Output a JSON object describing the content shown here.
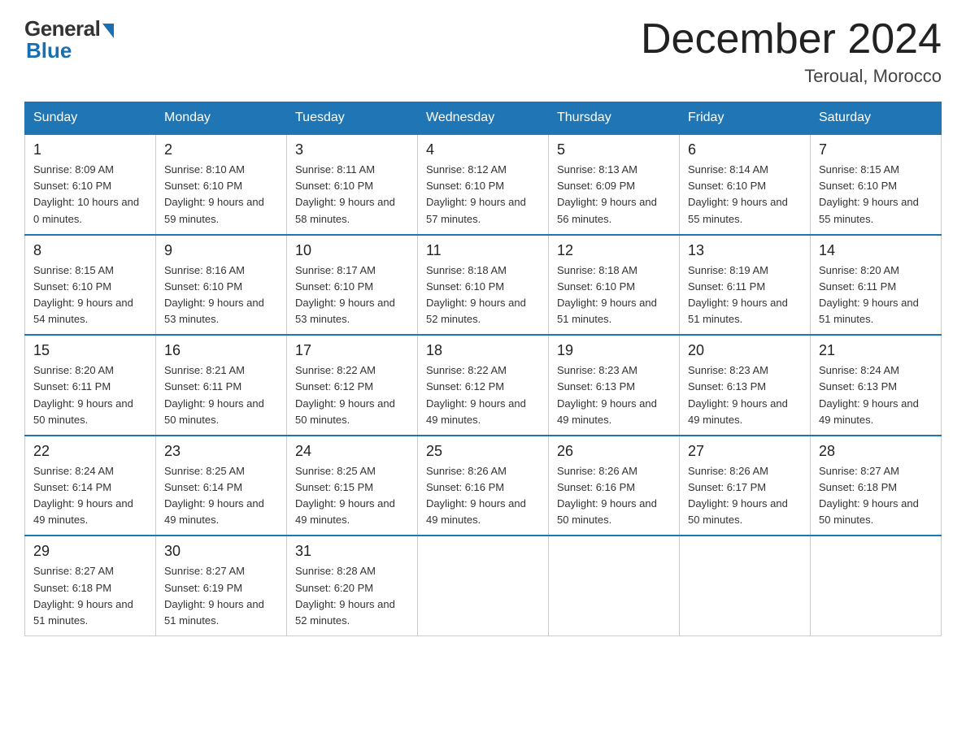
{
  "header": {
    "logo": {
      "general": "General",
      "blue": "Blue"
    },
    "title": "December 2024",
    "location": "Teroual, Morocco"
  },
  "weekdays": [
    "Sunday",
    "Monday",
    "Tuesday",
    "Wednesday",
    "Thursday",
    "Friday",
    "Saturday"
  ],
  "weeks": [
    [
      {
        "day": "1",
        "sunrise": "8:09 AM",
        "sunset": "6:10 PM",
        "daylight": "10 hours and 0 minutes."
      },
      {
        "day": "2",
        "sunrise": "8:10 AM",
        "sunset": "6:10 PM",
        "daylight": "9 hours and 59 minutes."
      },
      {
        "day": "3",
        "sunrise": "8:11 AM",
        "sunset": "6:10 PM",
        "daylight": "9 hours and 58 minutes."
      },
      {
        "day": "4",
        "sunrise": "8:12 AM",
        "sunset": "6:10 PM",
        "daylight": "9 hours and 57 minutes."
      },
      {
        "day": "5",
        "sunrise": "8:13 AM",
        "sunset": "6:09 PM",
        "daylight": "9 hours and 56 minutes."
      },
      {
        "day": "6",
        "sunrise": "8:14 AM",
        "sunset": "6:10 PM",
        "daylight": "9 hours and 55 minutes."
      },
      {
        "day": "7",
        "sunrise": "8:15 AM",
        "sunset": "6:10 PM",
        "daylight": "9 hours and 55 minutes."
      }
    ],
    [
      {
        "day": "8",
        "sunrise": "8:15 AM",
        "sunset": "6:10 PM",
        "daylight": "9 hours and 54 minutes."
      },
      {
        "day": "9",
        "sunrise": "8:16 AM",
        "sunset": "6:10 PM",
        "daylight": "9 hours and 53 minutes."
      },
      {
        "day": "10",
        "sunrise": "8:17 AM",
        "sunset": "6:10 PM",
        "daylight": "9 hours and 53 minutes."
      },
      {
        "day": "11",
        "sunrise": "8:18 AM",
        "sunset": "6:10 PM",
        "daylight": "9 hours and 52 minutes."
      },
      {
        "day": "12",
        "sunrise": "8:18 AM",
        "sunset": "6:10 PM",
        "daylight": "9 hours and 51 minutes."
      },
      {
        "day": "13",
        "sunrise": "8:19 AM",
        "sunset": "6:11 PM",
        "daylight": "9 hours and 51 minutes."
      },
      {
        "day": "14",
        "sunrise": "8:20 AM",
        "sunset": "6:11 PM",
        "daylight": "9 hours and 51 minutes."
      }
    ],
    [
      {
        "day": "15",
        "sunrise": "8:20 AM",
        "sunset": "6:11 PM",
        "daylight": "9 hours and 50 minutes."
      },
      {
        "day": "16",
        "sunrise": "8:21 AM",
        "sunset": "6:11 PM",
        "daylight": "9 hours and 50 minutes."
      },
      {
        "day": "17",
        "sunrise": "8:22 AM",
        "sunset": "6:12 PM",
        "daylight": "9 hours and 50 minutes."
      },
      {
        "day": "18",
        "sunrise": "8:22 AM",
        "sunset": "6:12 PM",
        "daylight": "9 hours and 49 minutes."
      },
      {
        "day": "19",
        "sunrise": "8:23 AM",
        "sunset": "6:13 PM",
        "daylight": "9 hours and 49 minutes."
      },
      {
        "day": "20",
        "sunrise": "8:23 AM",
        "sunset": "6:13 PM",
        "daylight": "9 hours and 49 minutes."
      },
      {
        "day": "21",
        "sunrise": "8:24 AM",
        "sunset": "6:13 PM",
        "daylight": "9 hours and 49 minutes."
      }
    ],
    [
      {
        "day": "22",
        "sunrise": "8:24 AM",
        "sunset": "6:14 PM",
        "daylight": "9 hours and 49 minutes."
      },
      {
        "day": "23",
        "sunrise": "8:25 AM",
        "sunset": "6:14 PM",
        "daylight": "9 hours and 49 minutes."
      },
      {
        "day": "24",
        "sunrise": "8:25 AM",
        "sunset": "6:15 PM",
        "daylight": "9 hours and 49 minutes."
      },
      {
        "day": "25",
        "sunrise": "8:26 AM",
        "sunset": "6:16 PM",
        "daylight": "9 hours and 49 minutes."
      },
      {
        "day": "26",
        "sunrise": "8:26 AM",
        "sunset": "6:16 PM",
        "daylight": "9 hours and 50 minutes."
      },
      {
        "day": "27",
        "sunrise": "8:26 AM",
        "sunset": "6:17 PM",
        "daylight": "9 hours and 50 minutes."
      },
      {
        "day": "28",
        "sunrise": "8:27 AM",
        "sunset": "6:18 PM",
        "daylight": "9 hours and 50 minutes."
      }
    ],
    [
      {
        "day": "29",
        "sunrise": "8:27 AM",
        "sunset": "6:18 PM",
        "daylight": "9 hours and 51 minutes."
      },
      {
        "day": "30",
        "sunrise": "8:27 AM",
        "sunset": "6:19 PM",
        "daylight": "9 hours and 51 minutes."
      },
      {
        "day": "31",
        "sunrise": "8:28 AM",
        "sunset": "6:20 PM",
        "daylight": "9 hours and 52 minutes."
      },
      null,
      null,
      null,
      null
    ]
  ]
}
